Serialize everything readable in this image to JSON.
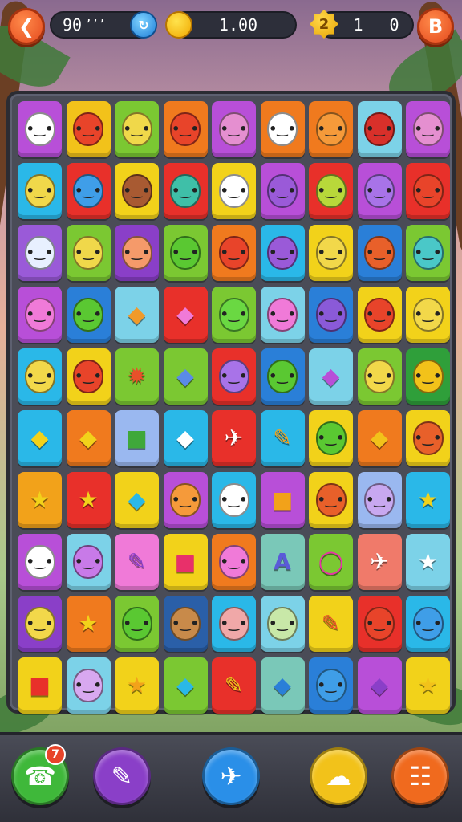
{
  "top_bar": {
    "back_icon": "back-arrow-icon",
    "left_counter": "90",
    "left_counter_suffix": "’’’",
    "blue_badge_icon": "timer-icon",
    "coins_value": "1.00",
    "gem_badge_label": "2",
    "score_a": "1",
    "score_b": "0",
    "menu_button_label": "B"
  },
  "board": {
    "rows": [
      [
        {
          "bg": "#b84fd8",
          "kind": "face",
          "face": "#ffffff",
          "icon": "ghost-face-icon"
        },
        {
          "bg": "#f2c21a",
          "kind": "face",
          "face": "#e8442a",
          "icon": "red-monster-icon"
        },
        {
          "bg": "#7bc832",
          "kind": "face",
          "face": "#f0d84a",
          "icon": "yellow-face-icon"
        },
        {
          "bg": "#f07a1e",
          "kind": "face",
          "face": "#e8442a",
          "icon": "red-monster-icon"
        },
        {
          "bg": "#b84fd8",
          "kind": "face",
          "face": "#e58fd0",
          "icon": "pink-cat-icon"
        },
        {
          "bg": "#f07a1e",
          "kind": "face",
          "face": "#ffffff",
          "icon": "robot-icon"
        },
        {
          "bg": "#f07a1e",
          "kind": "face",
          "face": "#f59a3a",
          "icon": "orange-monster-icon"
        },
        {
          "bg": "#7cd2e8",
          "kind": "face",
          "face": "#d8302a",
          "icon": "red-blob-icon"
        },
        {
          "bg": "#b84fd8",
          "kind": "face",
          "face": "#e58fd0",
          "icon": "pink-star-creature-icon"
        }
      ],
      [
        {
          "bg": "#2ab8e8",
          "kind": "face",
          "face": "#f0d84a",
          "icon": "yellow-face-icon"
        },
        {
          "bg": "#e8302a",
          "kind": "face",
          "face": "#3f9ee8",
          "icon": "blue-monster-icon"
        },
        {
          "bg": "#f2d21a",
          "kind": "face",
          "face": "#a85a32",
          "icon": "brown-face-icon"
        },
        {
          "bg": "#e8302a",
          "kind": "face",
          "face": "#3fbfa8",
          "icon": "teal-face-icon"
        },
        {
          "bg": "#f2d21a",
          "kind": "face",
          "face": "#ffffff",
          "icon": "ghost-face-icon"
        },
        {
          "bg": "#b84fd8",
          "kind": "face",
          "face": "#9a5ad8",
          "icon": "purple-monster-icon"
        },
        {
          "bg": "#e8302a",
          "kind": "face",
          "face": "#b8d83a",
          "icon": "green-face-icon"
        },
        {
          "bg": "#b84fd8",
          "kind": "face",
          "face": "#a873e8",
          "icon": "purple-cat-icon"
        },
        {
          "bg": "#e8302a",
          "kind": "face",
          "face": "#e8442a",
          "icon": "red-monster-icon"
        }
      ],
      [
        {
          "bg": "#9a5ad8",
          "kind": "face",
          "face": "#e8f0ff",
          "icon": "glasses-face-icon"
        },
        {
          "bg": "#7bc832",
          "kind": "face",
          "face": "#f0d84a",
          "icon": "yellow-cat-icon"
        },
        {
          "bg": "#8a3fc8",
          "kind": "face",
          "face": "#f59a6a",
          "icon": "glasses-face-icon"
        },
        {
          "bg": "#7bc832",
          "kind": "face",
          "face": "#5ac832",
          "icon": "green-drop-icon"
        },
        {
          "bg": "#f07a1e",
          "kind": "face",
          "face": "#e8442a",
          "icon": "red-drop-icon"
        },
        {
          "bg": "#2ab8e8",
          "kind": "face",
          "face": "#9a5ad8",
          "icon": "purple-drop-icon"
        },
        {
          "bg": "#f2d21a",
          "kind": "face",
          "face": "#f2d84a",
          "icon": "yellow-drop-icon"
        },
        {
          "bg": "#2a7fd8",
          "kind": "face",
          "face": "#e8602a",
          "icon": "orange-monster-icon"
        },
        {
          "bg": "#7bc832",
          "kind": "face",
          "face": "#4ac8c8",
          "icon": "teal-monster-icon"
        }
      ],
      [
        {
          "bg": "#b84fd8",
          "kind": "face",
          "face": "#f07ad8",
          "icon": "glasses-face-icon"
        },
        {
          "bg": "#2a7fd8",
          "kind": "face",
          "face": "#5ac832",
          "icon": "green-drop-icon"
        },
        {
          "bg": "#7cd2e8",
          "kind": "glyph",
          "glyph": "◆",
          "color": "#f09a2a",
          "icon": "orange-leaf-icon"
        },
        {
          "bg": "#e8302a",
          "kind": "glyph",
          "glyph": "◆",
          "color": "#f07ad8",
          "icon": "pink-balloon-icon"
        },
        {
          "bg": "#7bc832",
          "kind": "face",
          "face": "#6ad842",
          "icon": "green-face-icon"
        },
        {
          "bg": "#7cd2e8",
          "kind": "face",
          "face": "#f07ad8",
          "icon": "pink-monster-icon"
        },
        {
          "bg": "#2a7fd8",
          "kind": "face",
          "face": "#8a5ad8",
          "icon": "purple-face-icon"
        },
        {
          "bg": "#f2d21a",
          "kind": "face",
          "face": "#e8442a",
          "icon": "red-blob-icon"
        },
        {
          "bg": "#f2d21a",
          "kind": "face",
          "face": "#f2d84a",
          "icon": "yellow-face-icon"
        }
      ],
      [
        {
          "bg": "#2ab8e8",
          "kind": "face",
          "face": "#f2d84a",
          "icon": "yellow-face-icon"
        },
        {
          "bg": "#f2d21a",
          "kind": "face",
          "face": "#e8442a",
          "icon": "red-drop-icon"
        },
        {
          "bg": "#7bc832",
          "kind": "glyph",
          "glyph": "✹",
          "color": "#e8502a",
          "icon": "red-splat-icon"
        },
        {
          "bg": "#7bc832",
          "kind": "glyph",
          "glyph": "◆",
          "color": "#5a8ae8",
          "icon": "crystal-icon"
        },
        {
          "bg": "#e8302a",
          "kind": "face",
          "face": "#a873e8",
          "icon": "purple-monster-icon"
        },
        {
          "bg": "#2a7fd8",
          "kind": "face",
          "face": "#5ac832",
          "icon": "green-monster-icon"
        },
        {
          "bg": "#7cd2e8",
          "kind": "glyph",
          "glyph": "◆",
          "color": "#b84fd8",
          "icon": "purple-balloon-icon"
        },
        {
          "bg": "#7bc832",
          "kind": "face",
          "face": "#f2d84a",
          "icon": "yellow-cat-icon"
        },
        {
          "bg": "#2f9f3a",
          "kind": "face",
          "face": "#f2c21a",
          "icon": "yellow-drop-icon"
        }
      ],
      [
        {
          "bg": "#2ab8e8",
          "kind": "glyph",
          "glyph": "◆",
          "color": "#f2d21a",
          "icon": "yellow-leaf-icon"
        },
        {
          "bg": "#f07a1e",
          "kind": "glyph",
          "glyph": "◆",
          "color": "#f2d21a",
          "icon": "yellow-leaf-icon"
        },
        {
          "bg": "#9ab8f0",
          "kind": "glyph",
          "glyph": "■",
          "color": "#3fa83a",
          "icon": "green-book-icon"
        },
        {
          "bg": "#2ab8e8",
          "kind": "glyph",
          "glyph": "◆",
          "color": "#ffffff",
          "icon": "paper-gem-icon"
        },
        {
          "bg": "#e8302a",
          "kind": "glyph",
          "glyph": "✈",
          "color": "#ffffff",
          "icon": "paper-plane-icon"
        },
        {
          "bg": "#2ab8e8",
          "kind": "glyph",
          "glyph": "✎",
          "color": "#f2a21a",
          "icon": "pencil-icon"
        },
        {
          "bg": "#f2d21a",
          "kind": "face",
          "face": "#5ac832",
          "icon": "green-balloon-icon"
        },
        {
          "bg": "#f07a1e",
          "kind": "glyph",
          "glyph": "◆",
          "color": "#f2c21a",
          "icon": "yellow-arrow-icon"
        },
        {
          "bg": "#f2d21a",
          "kind": "face",
          "face": "#e8602a",
          "icon": "orange-monster-icon"
        }
      ],
      [
        {
          "bg": "#f2a21a",
          "kind": "glyph",
          "glyph": "★",
          "color": "#f2d21a",
          "icon": "star-icon"
        },
        {
          "bg": "#e8302a",
          "kind": "glyph",
          "glyph": "★",
          "color": "#f2d21a",
          "icon": "star-icon"
        },
        {
          "bg": "#f2d21a",
          "kind": "glyph",
          "glyph": "◆",
          "color": "#2ab8e8",
          "icon": "blue-leaf-icon"
        },
        {
          "bg": "#b84fd8",
          "kind": "face",
          "face": "#f59a3a",
          "icon": "orange-cat-icon"
        },
        {
          "bg": "#2ab8e8",
          "kind": "face",
          "face": "#ffffff",
          "icon": "ghost-face-icon"
        },
        {
          "bg": "#b84fd8",
          "kind": "glyph",
          "glyph": "■",
          "color": "#f2a21a",
          "icon": "notebook-icon"
        },
        {
          "bg": "#f2d21a",
          "kind": "face",
          "face": "#e8602a",
          "icon": "orange-monster-icon"
        },
        {
          "bg": "#9ab8f0",
          "kind": "face",
          "face": "#c8a8f0",
          "icon": "purple-balloon-icon"
        },
        {
          "bg": "#2ab8e8",
          "kind": "glyph",
          "glyph": "★",
          "color": "#f2d21a",
          "icon": "star-icon"
        }
      ],
      [
        {
          "bg": "#b84fd8",
          "kind": "face",
          "face": "#ffffff",
          "icon": "ghost-monster-icon"
        },
        {
          "bg": "#7cd2e8",
          "kind": "face",
          "face": "#c87ae8",
          "icon": "purple-cat-icon"
        },
        {
          "bg": "#f07ad8",
          "kind": "glyph",
          "glyph": "✎",
          "color": "#8a3fc8",
          "icon": "purple-pencil-icon"
        },
        {
          "bg": "#f2d21a",
          "kind": "glyph",
          "glyph": "■",
          "color": "#e8306a",
          "icon": "pink-square-icon"
        },
        {
          "bg": "#f07a1e",
          "kind": "face",
          "face": "#f07ad8",
          "icon": "pink-cat-icon"
        },
        {
          "bg": "#7ac8b8",
          "kind": "glyph",
          "glyph": "A",
          "color": "#5a5ad8",
          "icon": "letter-a-icon"
        },
        {
          "bg": "#7bc832",
          "kind": "glyph",
          "glyph": "◯",
          "color": "#e830a8",
          "icon": "pink-ring-icon"
        },
        {
          "bg": "#f07a6a",
          "kind": "glyph",
          "glyph": "✈",
          "color": "#ffffff",
          "icon": "paper-plane-icon"
        },
        {
          "bg": "#7cd2e8",
          "kind": "glyph",
          "glyph": "★",
          "color": "#ffffff",
          "icon": "white-star-icon"
        }
      ],
      [
        {
          "bg": "#8a3fc8",
          "kind": "face",
          "face": "#f2d84a",
          "icon": "yellow-face-icon"
        },
        {
          "bg": "#f07a1e",
          "kind": "glyph",
          "glyph": "★",
          "color": "#f2d21a",
          "icon": "star-icon"
        },
        {
          "bg": "#7bc832",
          "kind": "face",
          "face": "#5ac832",
          "icon": "green-drop-icon"
        },
        {
          "bg": "#2a5fa8",
          "kind": "face",
          "face": "#c88a4a",
          "icon": "hair-face-icon"
        },
        {
          "bg": "#2ab8e8",
          "kind": "face",
          "face": "#f0a8a8",
          "icon": "glasses-face-icon"
        },
        {
          "bg": "#7cd2e8",
          "kind": "face",
          "face": "#c8e8a8",
          "icon": "ghost-monster-icon"
        },
        {
          "bg": "#f2d21a",
          "kind": "glyph",
          "glyph": "✎",
          "color": "#e8502a",
          "icon": "orange-pencil-icon"
        },
        {
          "bg": "#e8302a",
          "kind": "face",
          "face": "#e8442a",
          "icon": "red-monster-icon"
        },
        {
          "bg": "#2ab8e8",
          "kind": "face",
          "face": "#3f9ee8",
          "icon": "blue-face-icon"
        }
      ],
      [
        {
          "bg": "#f2d21a",
          "kind": "glyph",
          "glyph": "■",
          "color": "#e8302a",
          "icon": "ticket-icon"
        },
        {
          "bg": "#7cd2e8",
          "kind": "face",
          "face": "#d8a8f0",
          "icon": "purple-drop-icon"
        },
        {
          "bg": "#f2d21a",
          "kind": "glyph",
          "glyph": "★",
          "color": "#f2a21a",
          "icon": "star-icon"
        },
        {
          "bg": "#7bc832",
          "kind": "glyph",
          "glyph": "◆",
          "color": "#2ab8e8",
          "icon": "blue-crystal-icon"
        },
        {
          "bg": "#e8302a",
          "kind": "glyph",
          "glyph": "✎",
          "color": "#f2d21a",
          "icon": "yellow-pencil-icon"
        },
        {
          "bg": "#7ac8b8",
          "kind": "glyph",
          "glyph": "◆",
          "color": "#2a7fd8",
          "icon": "blue-leaf-icon"
        },
        {
          "bg": "#2a7fd8",
          "kind": "face",
          "face": "#3f9ee8",
          "icon": "glasses-face-icon"
        },
        {
          "bg": "#b84fd8",
          "kind": "glyph",
          "glyph": "◆",
          "color": "#8a3fc8",
          "icon": "purple-crystal-icon"
        },
        {
          "bg": "#f2d21a",
          "kind": "glyph",
          "glyph": "★",
          "color": "#f2c21a",
          "icon": "star-icon"
        }
      ]
    ]
  },
  "bottom_bar": {
    "phone_badge": "7",
    "buttons": [
      {
        "name": "phone-button",
        "icon": "phone-icon",
        "glyph": "☎",
        "color": "#3fb83a"
      },
      {
        "name": "pencil-button",
        "icon": "pencil-icon",
        "glyph": "✎",
        "color": "#8a3fc8"
      },
      {
        "name": "plane-button",
        "icon": "paper-plane-icon",
        "glyph": "✈",
        "color": "#2a8fe8"
      },
      {
        "name": "cloud-button",
        "icon": "cloud-icon",
        "glyph": "☁",
        "color": "#f2c21a"
      },
      {
        "name": "grid-button",
        "icon": "grid-icon",
        "glyph": "☷",
        "color": "#f06a1e"
      }
    ]
  }
}
